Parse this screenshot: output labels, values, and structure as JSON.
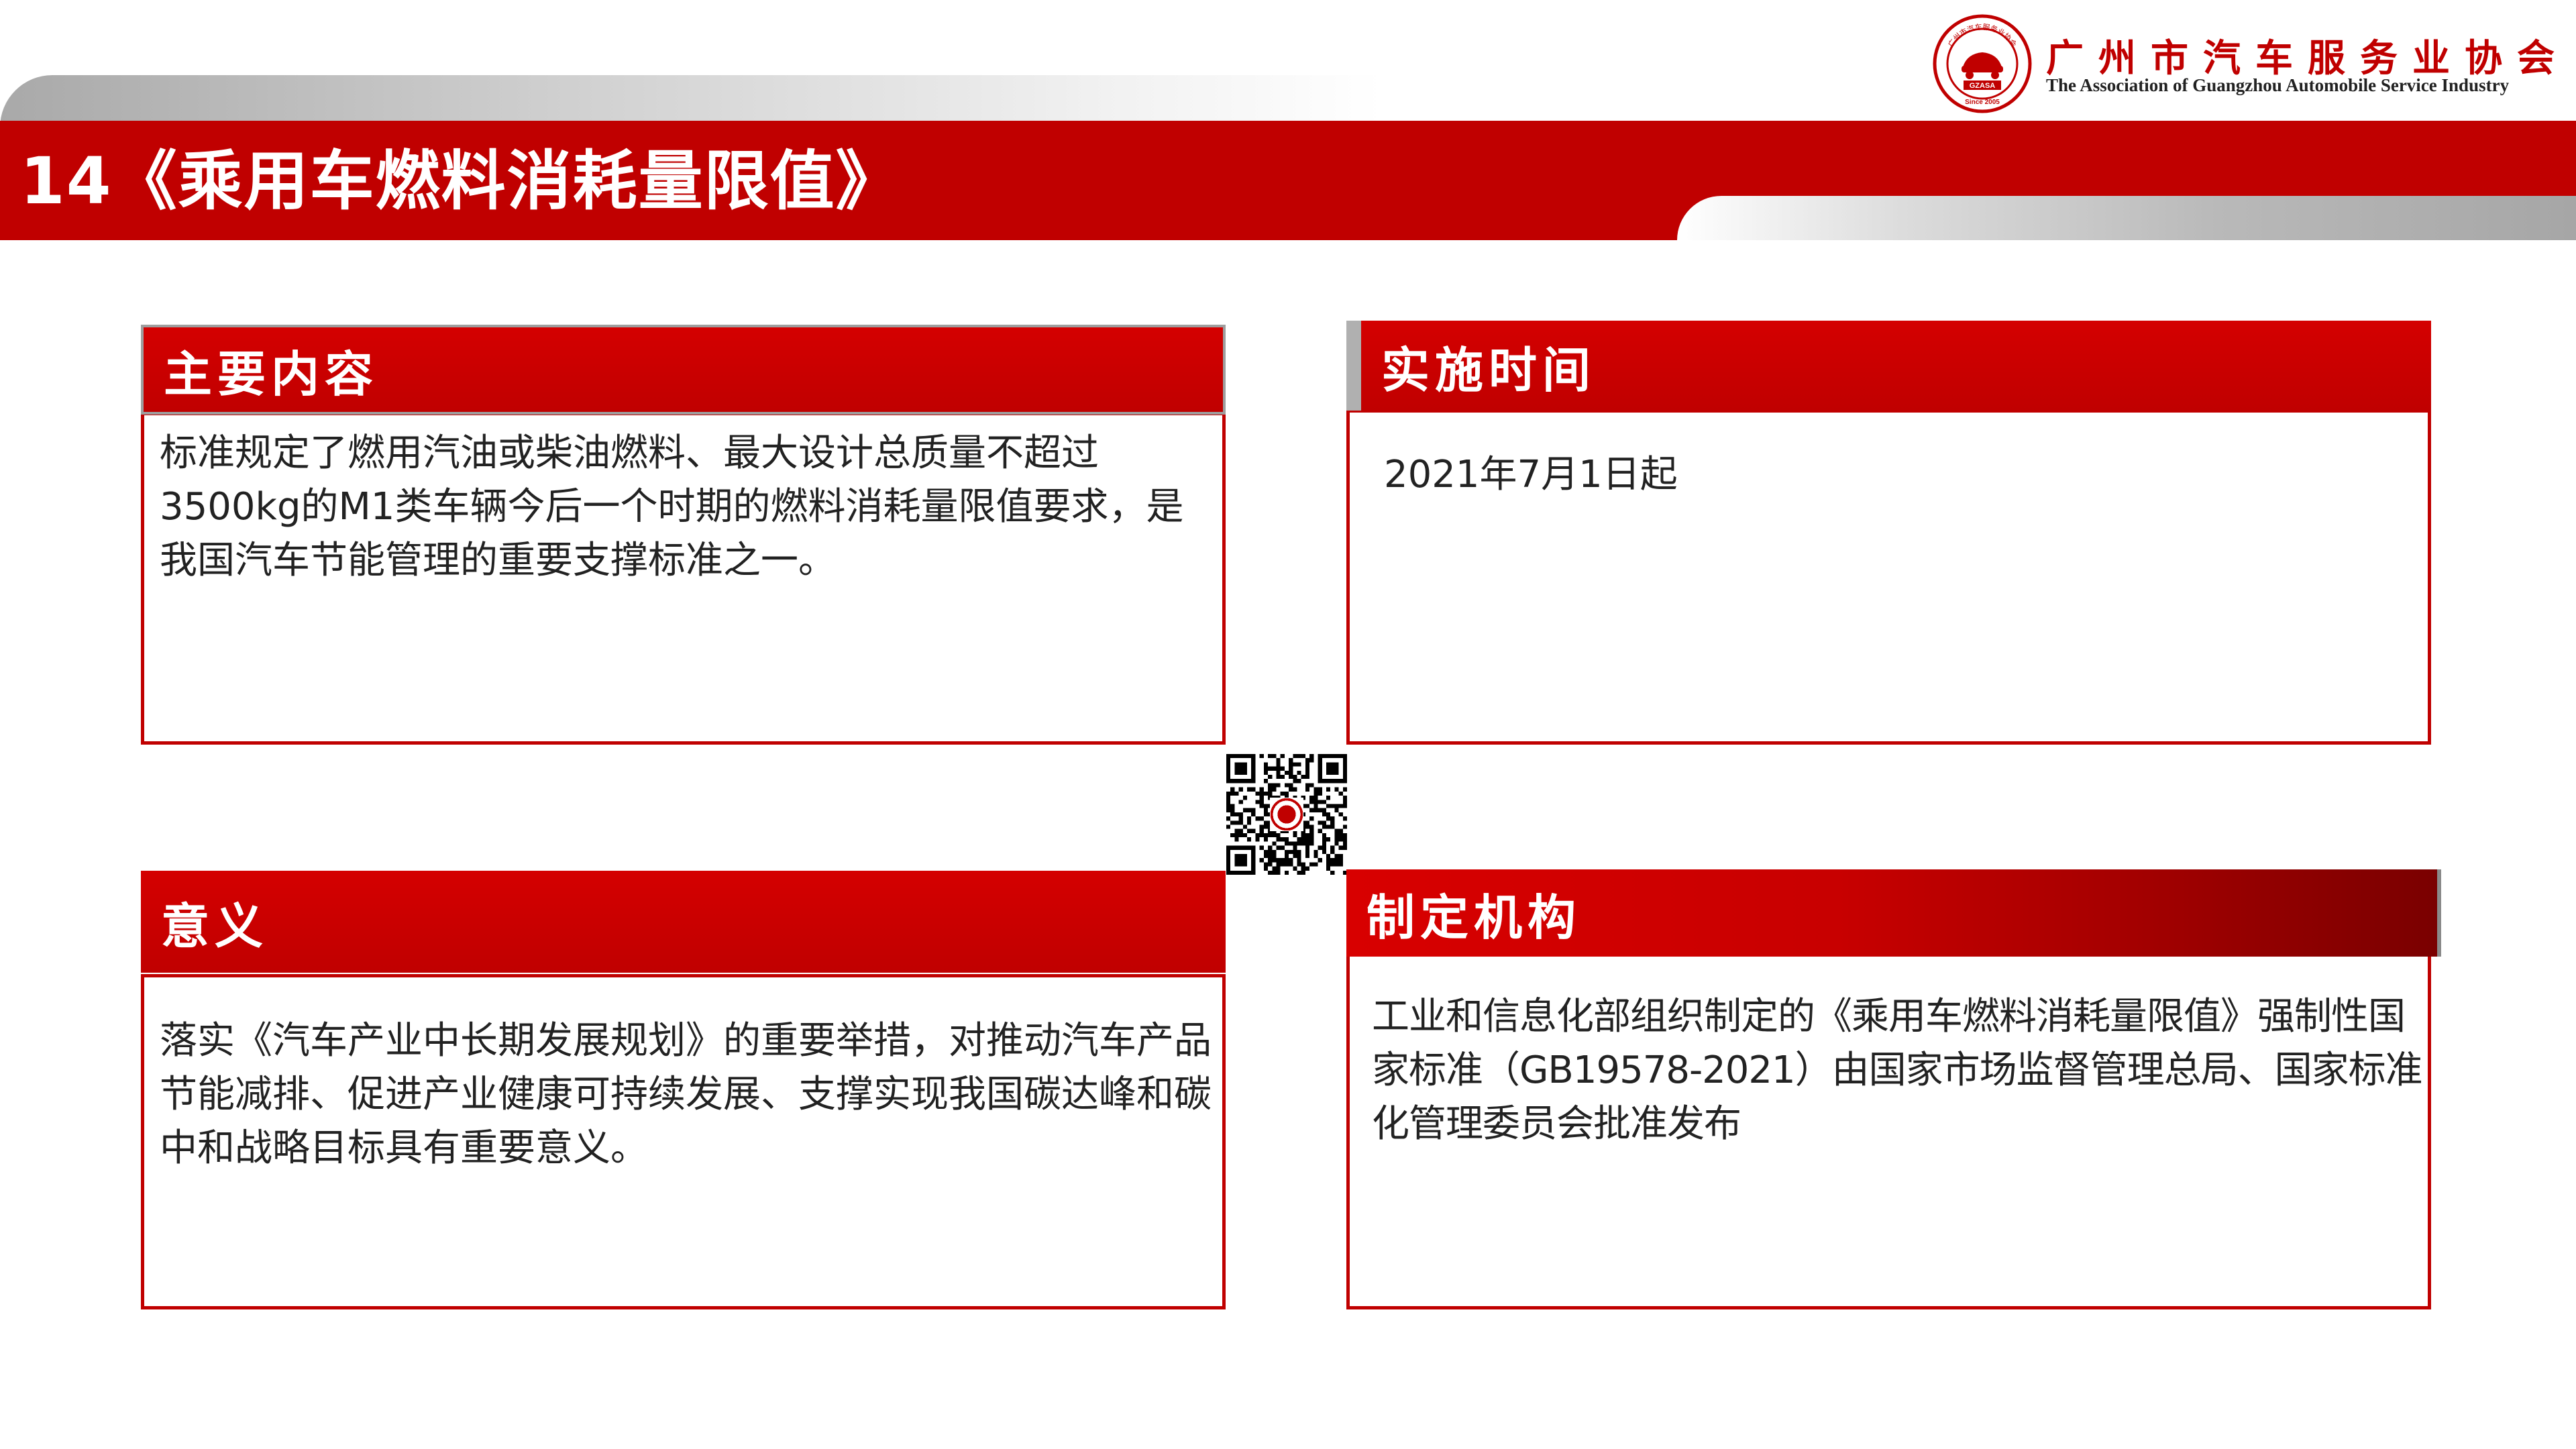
{
  "header": {
    "title": "14《乘用车燃料消耗量限值》"
  },
  "logo": {
    "name_cn": "广州市汽车服务业协会",
    "name_en": "The Association of Guangzhou Automobile Service Industry",
    "seal_abbr": "GZASA",
    "seal_since": "Since 2005",
    "seal_ring_text": "广州市汽车服务业协会"
  },
  "panels": {
    "main_content": {
      "title": "主要内容",
      "body": "标准规定了燃用汽油或柴油燃料、最大设计总质量不超过3500kg的M1类车辆今后一个时期的燃料消耗量限值要求，是我国汽车节能管理的重要支撑标准之一。"
    },
    "implementation_time": {
      "title": "实施时间",
      "body": "2021年7月1日起"
    },
    "significance": {
      "title": "意义",
      "body": " 落实《汽车产业中长期发展规划》的重要举措，对推动汽车产品节能减排、促进产业健康可持续发展、支撑实现我国碳达峰和碳中和战略目标具有重要意义。"
    },
    "issuing_body": {
      "title": "制定机构",
      "body": "工业和信息化部组织制定的《乘用车燃料消耗量限值》强制性国家标准（GB19578-2021）由国家市场监督管理总局、国家标准化管理委员会批准发布"
    }
  },
  "colors": {
    "brand_red": "#c00000",
    "border_red": "#c00000",
    "swoosh_grey": "#b0b0b0",
    "text": "#222222"
  },
  "icons": {
    "qr": "qr-code-icon",
    "seal": "association-seal-logo"
  }
}
